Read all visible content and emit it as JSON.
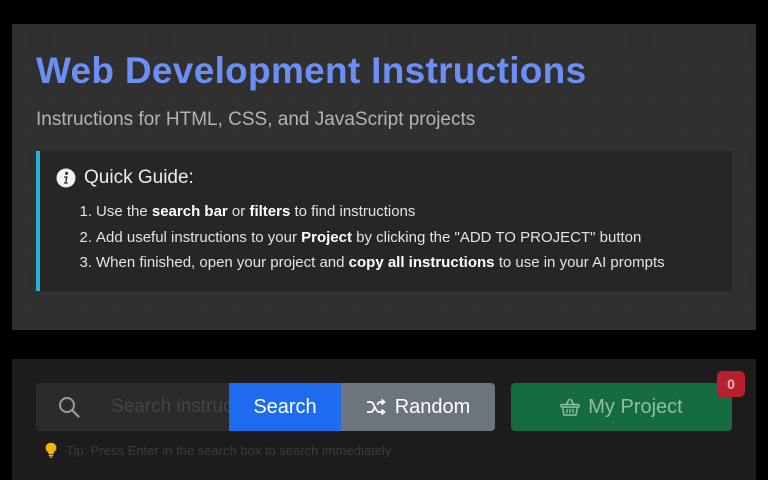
{
  "header": {
    "title": "Web Development Instructions",
    "subtitle": "Instructions for HTML, CSS, and JavaScript projects"
  },
  "guide": {
    "icon": "info-icon",
    "title": "Quick Guide:",
    "steps": [
      {
        "num": "1.",
        "parts": [
          "Use the ",
          "search bar",
          " or ",
          "filters",
          " to find instructions"
        ]
      },
      {
        "num": "2.",
        "parts": [
          "Add useful instructions to your ",
          "Project",
          " by clicking the \"ADD TO PROJECT\" button"
        ]
      },
      {
        "num": "3.",
        "parts": [
          "When finished, open your project and ",
          "copy all instructions",
          " to use in your AI prompts"
        ]
      }
    ]
  },
  "search": {
    "icon": "search-icon",
    "placeholder": "Search instructions...",
    "value": "",
    "search_label": "Search",
    "random_label": "Random",
    "random_icon": "shuffle-icon",
    "project_label": "My Project",
    "project_icon": "basket-icon",
    "project_count": "0",
    "tip_icon": "lightbulb-icon",
    "tip": "Tip: Press Enter in the search box to search immediately"
  },
  "colors": {
    "title": "#6c8ff5",
    "guide_accent": "#27b6d9",
    "search_button": "#1d6cf0",
    "random_button": "#6c757d",
    "project_button": "#146c3f",
    "badge": "#b8202e",
    "tip_icon": "#f2b705"
  }
}
